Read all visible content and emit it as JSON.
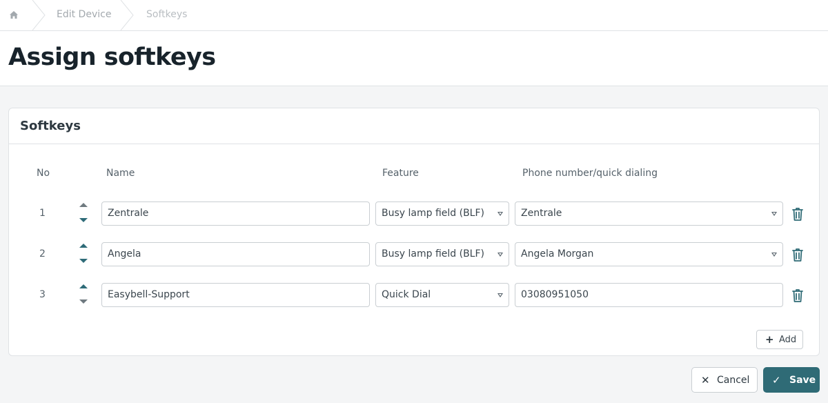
{
  "breadcrumb": {
    "home_icon": "home-icon",
    "items": [
      "Edit Device",
      "Softkeys"
    ]
  },
  "page": {
    "title": "Assign softkeys"
  },
  "card": {
    "title": "Softkeys",
    "columns": {
      "no": "No",
      "name": "Name",
      "feature": "Feature",
      "phone": "Phone number/quick dialing"
    },
    "rows": [
      {
        "no": "1",
        "name": "Zentrale",
        "feature": "Busy lamp field (BLF)",
        "phone": "Zentrale",
        "phone_is_select": true
      },
      {
        "no": "2",
        "name": "Angela",
        "feature": "Busy lamp field (BLF)",
        "phone": "Angela Morgan",
        "phone_is_select": true
      },
      {
        "no": "3",
        "name": "Easybell-Support",
        "feature": "Quick Dial",
        "phone": "03080951050",
        "phone_is_select": false
      }
    ],
    "add_label": "Add"
  },
  "footer": {
    "cancel_label": "Cancel",
    "save_label": "Save"
  },
  "colors": {
    "accent": "#2f6b76",
    "border": "#c9ced2",
    "background": "#f4f5f6"
  }
}
